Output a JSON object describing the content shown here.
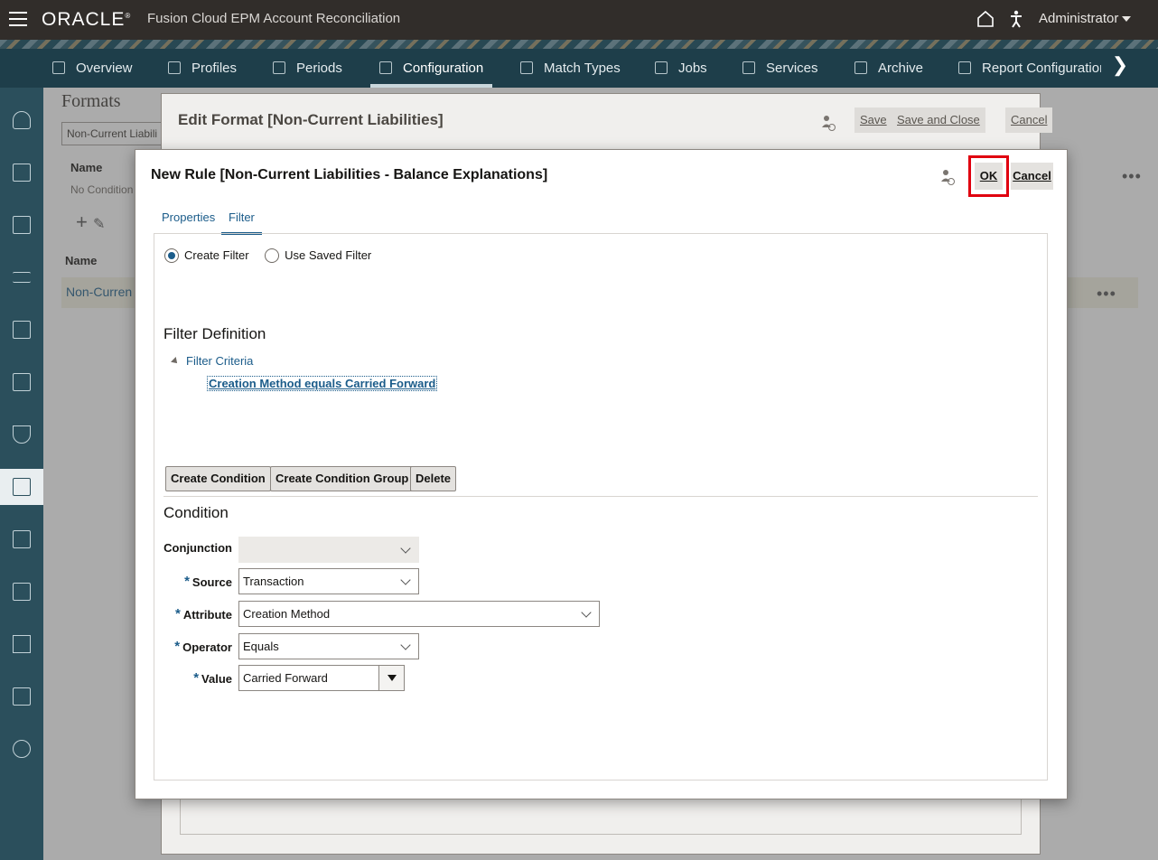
{
  "header": {
    "logo": "ORACLE",
    "logo_mark": "®",
    "app_title": "Fusion Cloud EPM Account Reconciliation",
    "user_name": "Administrator"
  },
  "nav": {
    "tabs": [
      {
        "label": "Overview",
        "icon": "overview-icon"
      },
      {
        "label": "Profiles",
        "icon": "profiles-icon"
      },
      {
        "label": "Periods",
        "icon": "periods-icon"
      },
      {
        "label": "Configuration",
        "icon": "configuration-icon",
        "active": true
      },
      {
        "label": "Match Types",
        "icon": "match-types-icon"
      },
      {
        "label": "Jobs",
        "icon": "jobs-icon"
      },
      {
        "label": "Services",
        "icon": "services-icon"
      },
      {
        "label": "Archive",
        "icon": "archive-icon"
      },
      {
        "label": "Report Configuratior",
        "icon": "report-configuration-icon"
      }
    ]
  },
  "background_page": {
    "title": "Formats",
    "select_value": "Non-Current Liabili",
    "column_name": "Name",
    "no_conditions": "No Condition",
    "list_column_name": "Name",
    "row_name": "Non-Curren"
  },
  "edit_dialog": {
    "title": "Edit Format [Non-Current Liabilities]",
    "save": "Save",
    "save_and_close": "Save and Close",
    "cancel": "Cancel"
  },
  "rule_dialog": {
    "title": "New Rule [Non-Current Liabilities - Balance Explanations]",
    "ok": "OK",
    "cancel": "Cancel",
    "tabs": [
      "Properties",
      "Filter"
    ],
    "active_tab": "Filter",
    "radio_create": "Create Filter",
    "radio_saved": "Use Saved Filter",
    "filter_definition": "Filter Definition",
    "filter_criteria": "Filter Criteria",
    "criteria_item": "Creation Method equals Carried Forward",
    "buttons": {
      "create_condition": "Create Condition",
      "create_group": "Create Condition Group",
      "delete": "Delete"
    },
    "condition_heading": "Condition",
    "fields": {
      "conjunction_label": "Conjunction",
      "conjunction_value": "",
      "source_label": "Source",
      "source_value": "Transaction",
      "attribute_label": "Attribute",
      "attribute_value": "Creation Method",
      "operator_label": "Operator",
      "operator_value": "Equals",
      "value_label": "Value",
      "value_value": "Carried Forward",
      "required_mark": "*"
    }
  },
  "colors": {
    "header_bg": "#312d2a",
    "nav_bg": "#1e3e4a",
    "rail_bg": "#2b4f5c",
    "link": "#1b5c8a",
    "highlight": "#e0000f"
  }
}
